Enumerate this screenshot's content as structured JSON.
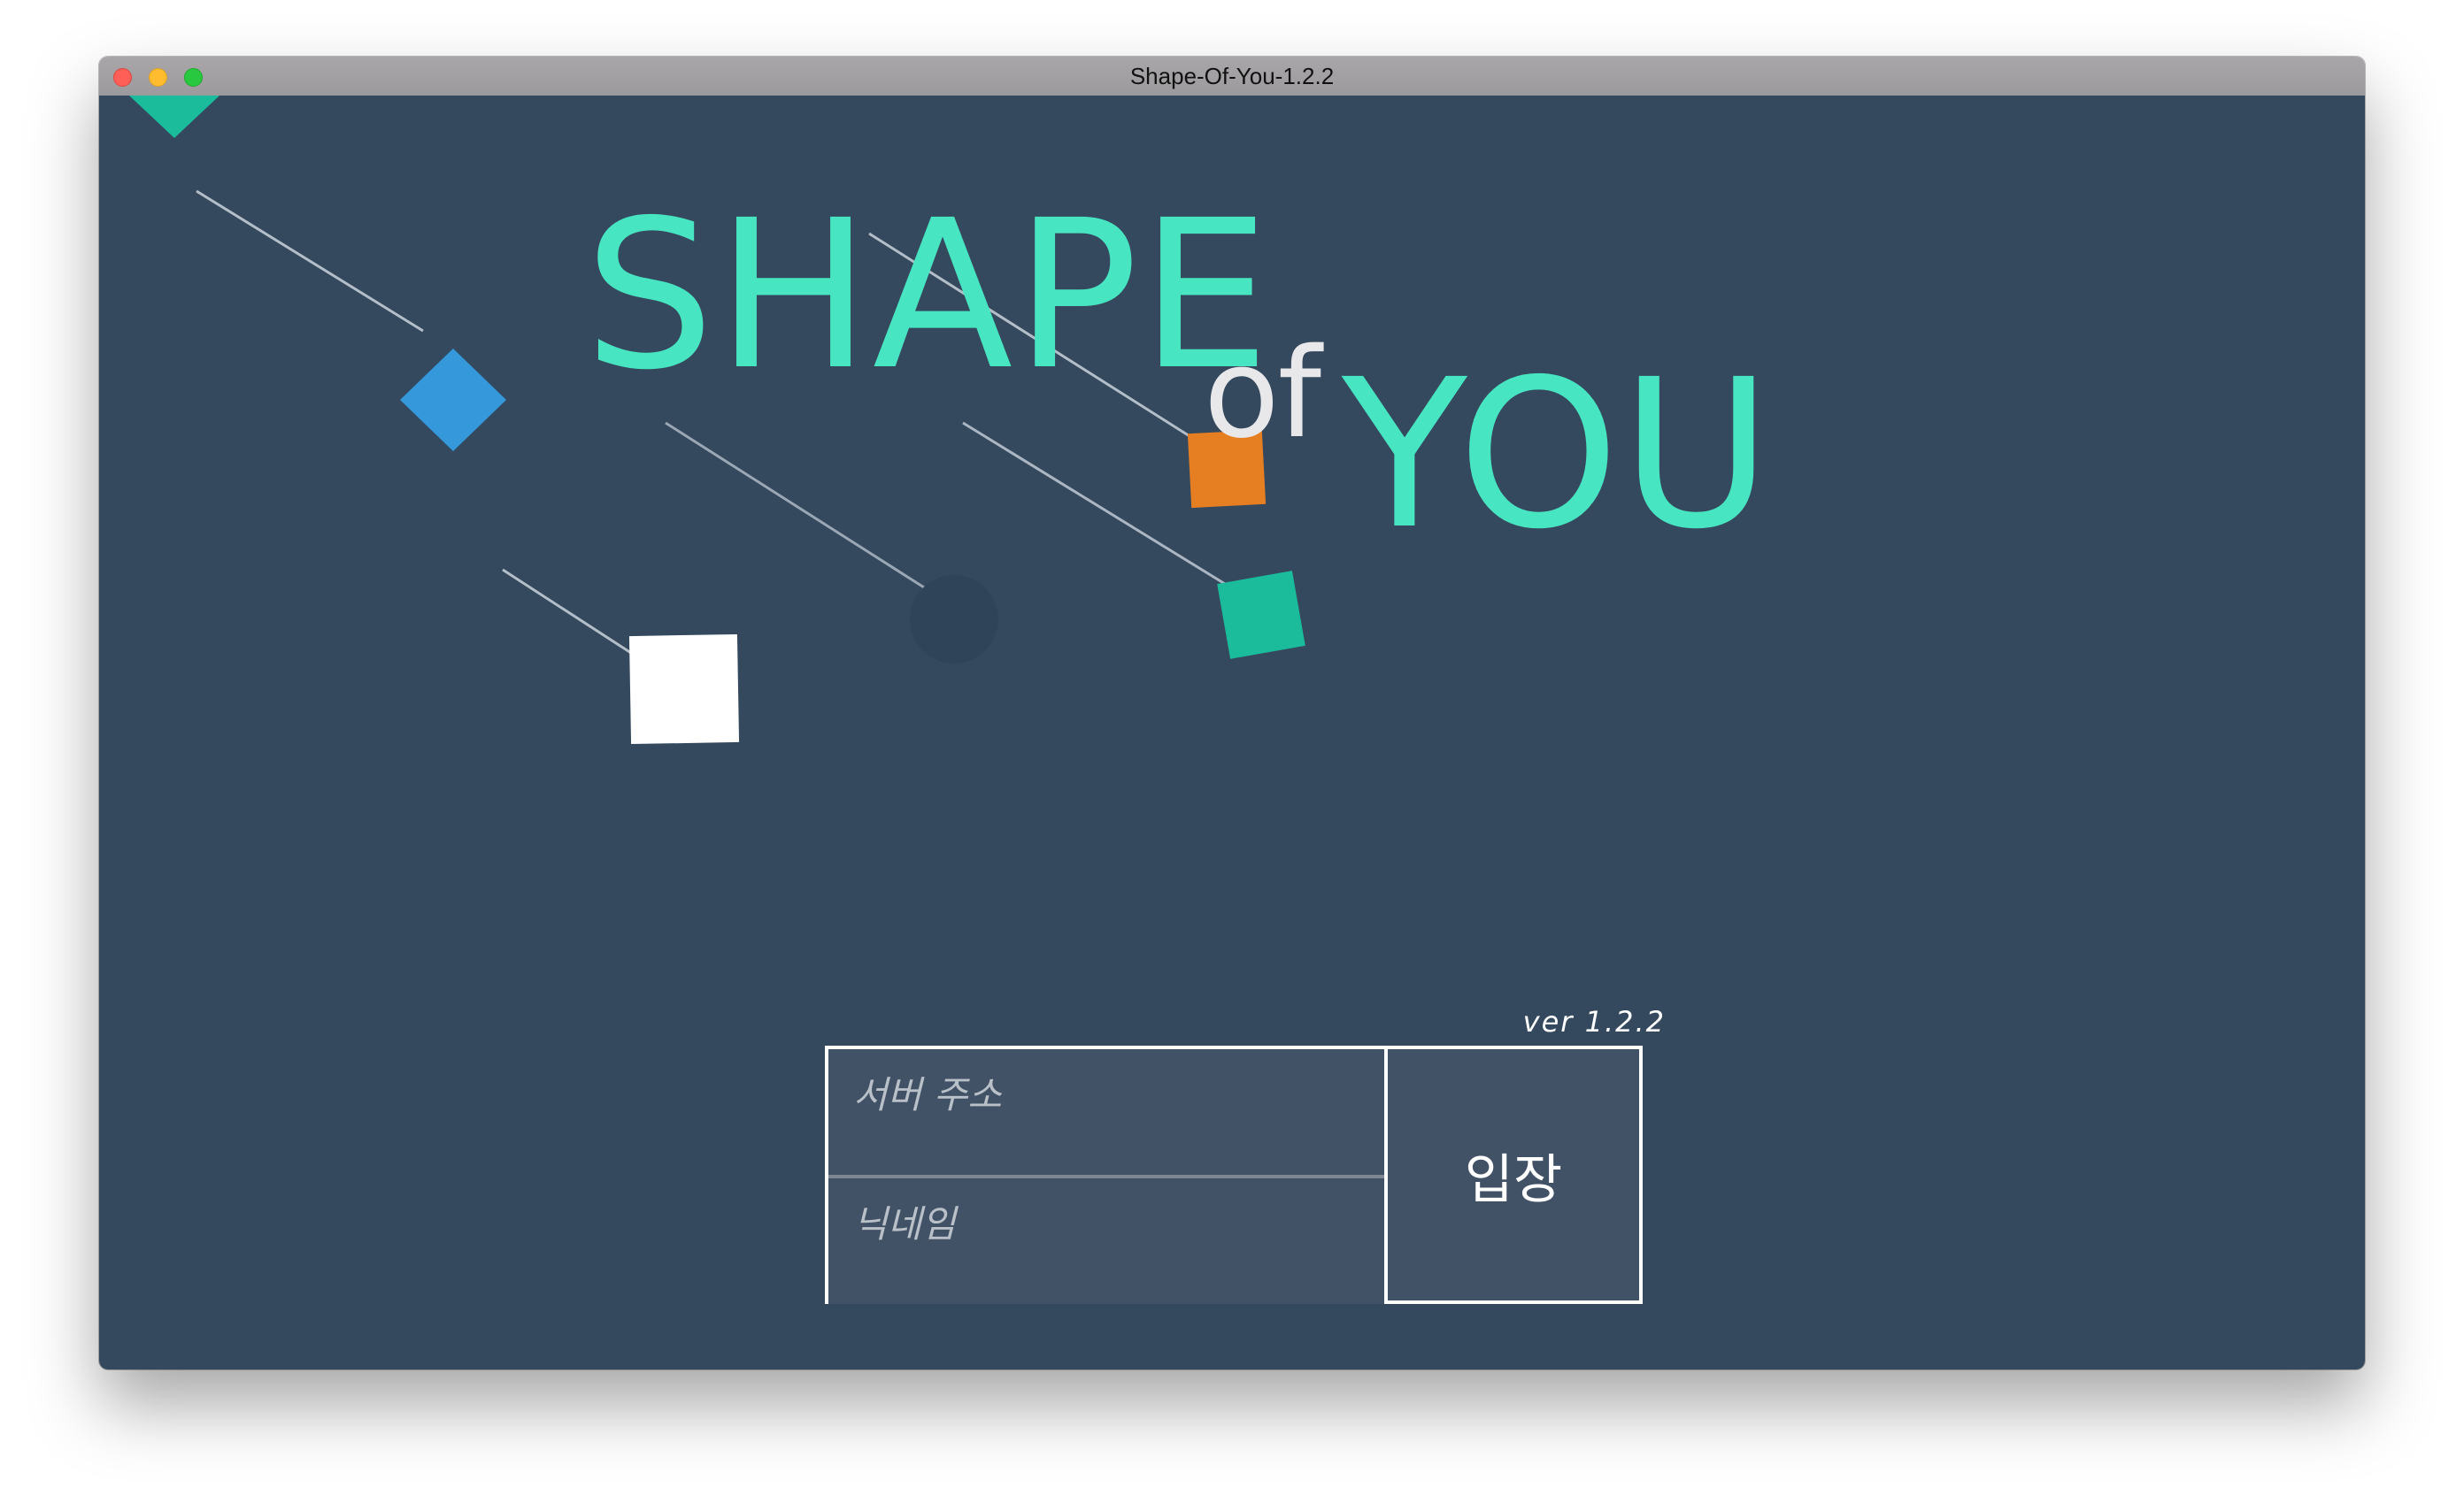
{
  "window": {
    "title": "Shape-Of-You-1.2.2"
  },
  "logo": {
    "word_shape": "SHAPE",
    "word_of": "of",
    "word_you": "YOU"
  },
  "login": {
    "version": "ver  1.2.2",
    "server_placeholder": "서버 주소",
    "nickname_placeholder": "닉네임",
    "enter_label": "입장"
  },
  "colors": {
    "background": "#34495e",
    "accent_teal": "#48e5c2",
    "logo_of": "#e8e8ea",
    "shape_blue": "#3498db",
    "shape_orange": "#e67e22",
    "shape_green": "#1abc9c",
    "shape_white": "#ffffff"
  },
  "shapes": [
    {
      "kind": "triangle",
      "color": "green"
    },
    {
      "kind": "diamond",
      "color": "blue"
    },
    {
      "kind": "square",
      "color": "orange"
    },
    {
      "kind": "square",
      "color": "green"
    },
    {
      "kind": "square",
      "color": "white"
    },
    {
      "kind": "circle",
      "color": "dark"
    }
  ]
}
